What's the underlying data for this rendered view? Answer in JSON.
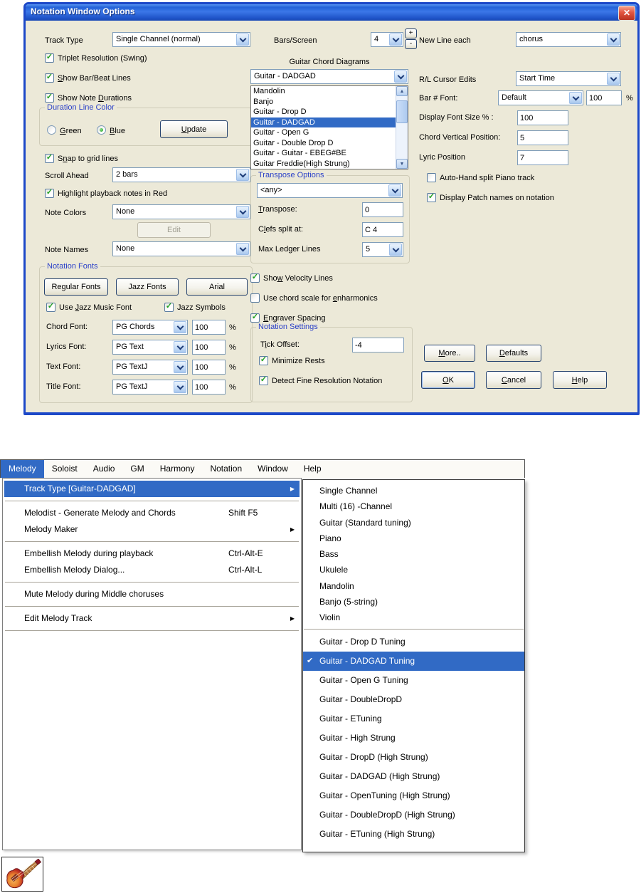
{
  "icons": {
    "close": "✕",
    "check": "✓",
    "menu_check": "✔",
    "arrow": "▶",
    "up": "▲",
    "down": "▼"
  },
  "colors": {
    "selection_blue": "#316AC5",
    "check_green": "#21A121",
    "group_title_blue": "#2B41C8",
    "titlebar_blue": "#2563D8",
    "close_red": "#D8452E",
    "dialog_bg": "#ECE9D8"
  },
  "dialog": {
    "title": "Notation Window Options",
    "left": {
      "track_type_label": "Track Type",
      "track_type_value": "Single Channel (normal)",
      "cb_triplet": "Triplet Resolution (Swing)",
      "cb_show_bar": "<u>S</u>how Bar/Beat Lines",
      "cb_show_dur": "Show Note <u>D</u>urations",
      "grp_duration": "Duration Line Color",
      "radio_green": "<u>G</u>reen",
      "radio_blue": "<u>B</u>lue",
      "btn_update": "<u>U</u>pdate",
      "cb_snap": "S<u>n</u>ap to grid lines",
      "scroll_label": "Scroll Ahead",
      "scroll_value": "2 bars",
      "cb_highlight": "Highlight playback notes in Red",
      "note_colors_label": "Note Colors",
      "note_colors_value": "None",
      "btn_edit": "Edit",
      "note_names_label": "Note Names",
      "note_names_value": "None",
      "grp_fonts": "Notation Fonts",
      "btn_regular": "Regular Fonts",
      "btn_jazz": "Jazz Fonts",
      "btn_arial": "Arial",
      "cb_use_jazz": "Use <u>J</u>azz Music Font",
      "cb_jazz_symbols": "Jazz Symbols",
      "font_rows": [
        {
          "label": "Chord Font:",
          "font": "PG Chords",
          "size": "100",
          "unit": "%"
        },
        {
          "label": "Lyrics Font:",
          "font": "PG Text",
          "size": "100",
          "unit": "%"
        },
        {
          "label": "Text Font:",
          "font": "PG TextJ",
          "size": "100",
          "unit": "%"
        },
        {
          "label": "Title Font:",
          "font": "PG TextJ",
          "size": "100",
          "unit": "%"
        }
      ]
    },
    "middle": {
      "bars_label": "Bars/Screen",
      "bars_value": "4",
      "spin_plus": "+",
      "spin_minus": "-",
      "gcd_title": "Guitar Chord Diagrams",
      "gcd_value": "Guitar - DADGAD",
      "gcd_items": [
        "Mandolin",
        "Banjo",
        "Guitar - Drop D",
        "Guitar - DADGAD",
        "Guitar - Open G",
        "Guitar - Double Drop D",
        "Guitar - Guitar - EBEG#BE",
        "Guitar Freddie(High Strung)"
      ],
      "gcd_selected": "Guitar - DADGAD",
      "grp_transpose": "Transpose Options",
      "any_value": "<any>",
      "transpose_label": "<u>T</u>ranspose:",
      "transpose_value": "0",
      "clefs_label": "C<u>l</u>efs split at:",
      "clefs_value": "C 4",
      "ledger_label": "Max Ledger Lines",
      "ledger_value": "5",
      "cb_velocity": "Sho<u>w</u> Velocity Lines",
      "cb_enharmonics": "Use chord scale for <u>e</u>nharmonics",
      "cb_engraver": "<u>E</u>ngraver Spacing",
      "grp_settings": "Notation Settings",
      "tick_label": "T<u>i</u>ck Offset:",
      "tick_value": "-4",
      "cb_minimize": "Minimize Rests",
      "cb_detect": "Detect Fine Resolution Notation"
    },
    "right": {
      "new_line_label": "New Line each",
      "new_line_value": "chorus",
      "cursor_label": "R/L Cursor Edits",
      "cursor_value": "Start Time",
      "bar_font_label": "Bar # Font:",
      "bar_font_value": "Default",
      "bar_font_size": "100",
      "bar_font_unit": "%",
      "display_label": "Display Font Size % :",
      "display_value": "100",
      "chord_vert_label": "Chord Vertical Position:",
      "chord_vert_value": "5",
      "lyric_label": "Lyric Position",
      "lyric_value": "7",
      "cb_autohand": "Auto-Hand split Piano track",
      "cb_patch": "Display Patch names on notation",
      "btn_more": "<u>M</u>ore..",
      "btn_defaults": "<u>D</u>efaults",
      "btn_ok": "<u>O</u>K",
      "btn_cancel": "<u>C</u>ancel",
      "btn_help": "<u>H</u>elp"
    }
  },
  "menu": {
    "bar": [
      "Melody",
      "Soloist",
      "Audio",
      "GM",
      "Harmony",
      "Notation",
      "Window",
      "Help"
    ],
    "active_item": "Melody",
    "dropdown": {
      "track_type": "Track Type [Guitar-DADGAD]",
      "melodist": "Melodist - Generate Melody and Chords",
      "melodist_shortcut": "Shift F5",
      "maker": "Melody Maker",
      "embellish": "Embellish Melody during playback",
      "embellish_shortcut": "Ctrl-Alt-E",
      "embellish_dialog": "Embellish Melody Dialog...",
      "embellish_dialog_shortcut": "Ctrl-Alt-L",
      "mute": "Mute Melody during Middle choruses",
      "edit_track": "Edit Melody Track"
    },
    "submenu": {
      "group1": [
        "Single Channel",
        "Multi (16) -Channel",
        "Guitar (Standard tuning)",
        "Piano",
        "Bass",
        "Ukulele",
        "Mandolin",
        "Banjo (5-string)",
        "Violin"
      ],
      "group2": [
        "Guitar - Drop D Tuning",
        "Guitar - DADGAD Tuning",
        "Guitar - Open G Tuning",
        "Guitar - DoubleDropD",
        "Guitar - ETuning",
        "Guitar - High Strung",
        "Guitar - DropD (High Strung)",
        "Guitar - DADGAD (High Strung)",
        "Guitar - OpenTuning (High Strung)",
        "Guitar - DoubleDropD (High Strung)",
        "Guitar - ETuning (High Strung)"
      ],
      "checked_item": "Guitar - DADGAD Tuning"
    }
  }
}
